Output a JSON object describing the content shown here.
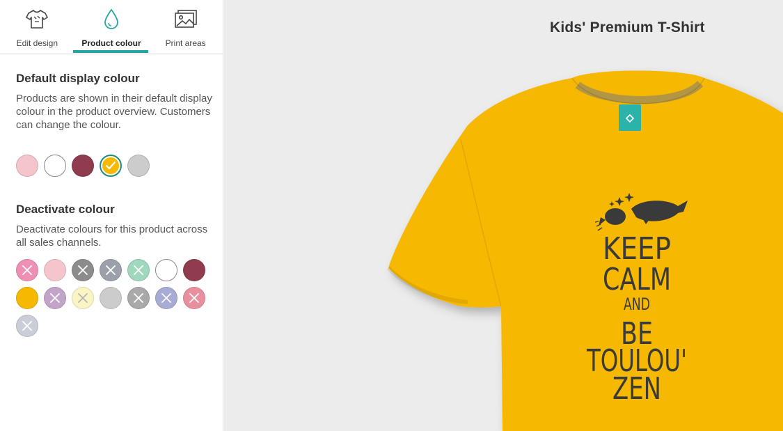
{
  "tabs": [
    {
      "label": "Edit design",
      "icon": "tshirt-icon"
    },
    {
      "label": "Product colour",
      "icon": "drop-icon",
      "active": true
    },
    {
      "label": "Print areas",
      "icon": "image-icon"
    }
  ],
  "default_colour": {
    "title": "Default display colour",
    "description": "Products are shown in their default display colour in the product overview. Customers can change the colour.",
    "selected": "#f6b800",
    "swatches": [
      "#f4c6cb",
      "#ffffff",
      "#8f3c4e",
      "#f6b800",
      "#cccccc"
    ]
  },
  "deactivate_colour": {
    "title": "Deactivate colour",
    "description": "Deactivate colours for this product across all sales channels.",
    "swatches": [
      {
        "color": "#f08fb4",
        "deactivated": true
      },
      {
        "color": "#f4c6cb",
        "deactivated": false
      },
      {
        "color": "#8c8c8c",
        "deactivated": true
      },
      {
        "color": "#9ba0ab",
        "deactivated": true
      },
      {
        "color": "#9fd8bc",
        "deactivated": true
      },
      {
        "color": "#ffffff",
        "deactivated": false
      },
      {
        "color": "#8f3c4e",
        "deactivated": false
      },
      {
        "color": "#f6b800",
        "deactivated": false
      },
      {
        "color": "#c2a4c8",
        "deactivated": true
      },
      {
        "color": "#fbf5c5",
        "deactivated": true
      },
      {
        "color": "#cccccc",
        "deactivated": false
      },
      {
        "color": "#a9a9a9",
        "deactivated": true
      },
      {
        "color": "#a8abd3",
        "deactivated": true
      },
      {
        "color": "#e9909f",
        "deactivated": true
      },
      {
        "color": "#c9ced9",
        "deactivated": true
      }
    ]
  },
  "preview": {
    "product_name": "Kids' Premium T-Shirt",
    "shirt_colour": "#f6b800",
    "print_colour": "#3a3a3a",
    "print_lines": [
      "KEEP",
      "CALM",
      "AND",
      "BE",
      "TOULOU'",
      "ZEN"
    ]
  }
}
